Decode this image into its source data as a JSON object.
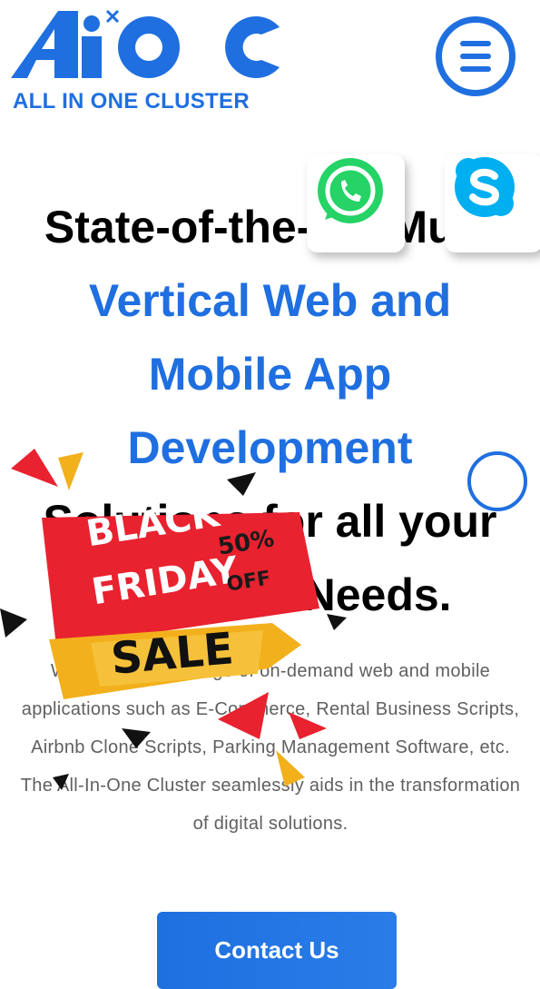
{
  "brand": {
    "logo_text": "AiOC",
    "logo_tagline": "ALL IN ONE CLUSTER",
    "color": "#1f6fe0"
  },
  "header": {
    "menu_icon": "hamburger-icon"
  },
  "hero": {
    "line1": "State-of-the-Art Multi",
    "line2": "Vertical Web and",
    "line3": "Mobile App",
    "line4": "Development",
    "line5": "Solutions for all your",
    "line6": "Business Needs."
  },
  "description": {
    "text": "We offer a wide range of on-demand web and mobile applications such as E-Commerce, Rental Business Scripts, Airbnb Clone Scripts, Parking Management Software, etc. The All-In-One Cluster seamlessly aids in the transformation of digital solutions."
  },
  "cta": {
    "label": "Contact Us"
  },
  "floating_social": [
    {
      "icon": "whatsapp-icon",
      "color": "#25d366"
    },
    {
      "icon": "skype-icon",
      "color": "#00aff0"
    }
  ],
  "promo_badge": {
    "line1": "BLACK",
    "line2": "FRIDAY",
    "discount": "50%",
    "discount_suffix": "OFF",
    "tag": "SALE"
  }
}
